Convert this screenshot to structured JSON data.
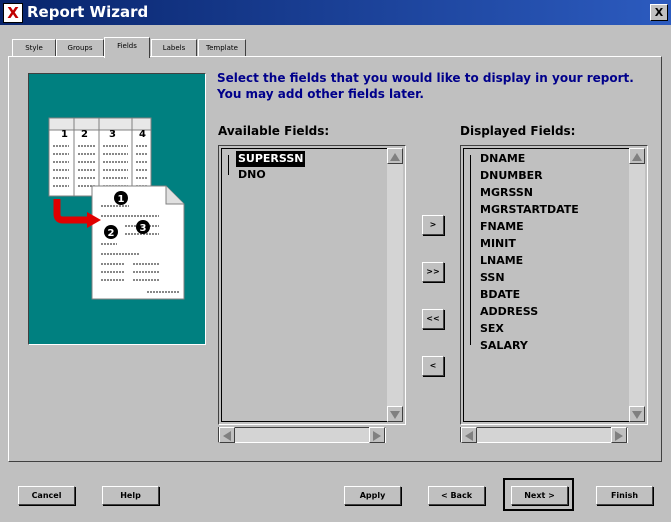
{
  "window": {
    "title": "Report Wizard",
    "close_label": "X",
    "app_icon": "X"
  },
  "tabs": [
    {
      "label": "Style",
      "active": false
    },
    {
      "label": "Groups",
      "active": false
    },
    {
      "label": "Fields",
      "active": true
    },
    {
      "label": "Labels",
      "active": false
    },
    {
      "label": "Template",
      "active": false
    }
  ],
  "instructions": "Select the fields that you would like to display in your report. You may add other fields later.",
  "available": {
    "label": "Available Fields:",
    "items": [
      "SUPERSSN",
      "DNO"
    ],
    "selected_index": 0
  },
  "displayed": {
    "label": "Displayed Fields:",
    "items": [
      "DNAME",
      "DNUMBER",
      "MGRSSN",
      "MGRSTARTDATE",
      "FNAME",
      "MINIT",
      "LNAME",
      "SSN",
      "BDATE",
      "ADDRESS",
      "SEX",
      "SALARY"
    ]
  },
  "move_buttons": {
    "add_one": ">",
    "add_all": ">>",
    "remove_all": "<<",
    "remove_one": "<"
  },
  "illustration": {
    "columns": [
      "1",
      "2",
      "3",
      "4"
    ],
    "badges": [
      "1",
      "2",
      "3"
    ]
  },
  "buttons": {
    "cancel": "Cancel",
    "help": "Help",
    "apply": "Apply",
    "back": "< Back",
    "next": "Next >",
    "finish": "Finish"
  }
}
